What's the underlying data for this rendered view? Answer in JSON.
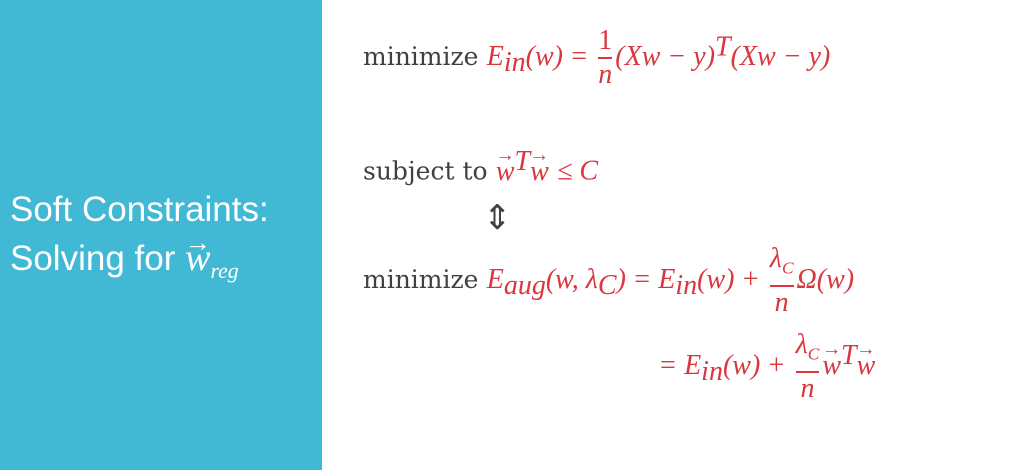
{
  "sidebar": {
    "title_line1": "Soft Constraints:",
    "title_line2_prefix": "Solving for ",
    "title_var": "w",
    "title_sub": "reg",
    "bg_color": "#41b8d4"
  },
  "eq1": {
    "word": "minimize",
    "E": "E",
    "in": "in",
    "lhs_arg": "(w)",
    "equals": "=",
    "num": "1",
    "den": "n",
    "rhs1": "(Xw − y)",
    "T": "T",
    "rhs2": "(Xw − y)"
  },
  "eq2": {
    "word": "subject to",
    "w1": "w",
    "T": "T",
    "w2": "w",
    "rel": "≤ C"
  },
  "arrow": "⇕",
  "eq3": {
    "word": "minimize",
    "E": "E",
    "aug": "aug",
    "args": "(w, λ",
    "C": "C",
    "close": ")",
    "equals": "=",
    "Ein": "E",
    "in": "in",
    "w": "(w)",
    "plus": "+",
    "num": "λ",
    "numsub": "C",
    "den": "n",
    "omega": "Ω(w)"
  },
  "eq4": {
    "equals": "=",
    "Ein": "E",
    "in": "in",
    "w": "(w)",
    "plus": "+",
    "num": "λ",
    "numsub": "C",
    "den": "n",
    "w1": "w",
    "T": "T",
    "w2": "w"
  },
  "colors": {
    "math": "#d9363e",
    "text": "#404040"
  }
}
